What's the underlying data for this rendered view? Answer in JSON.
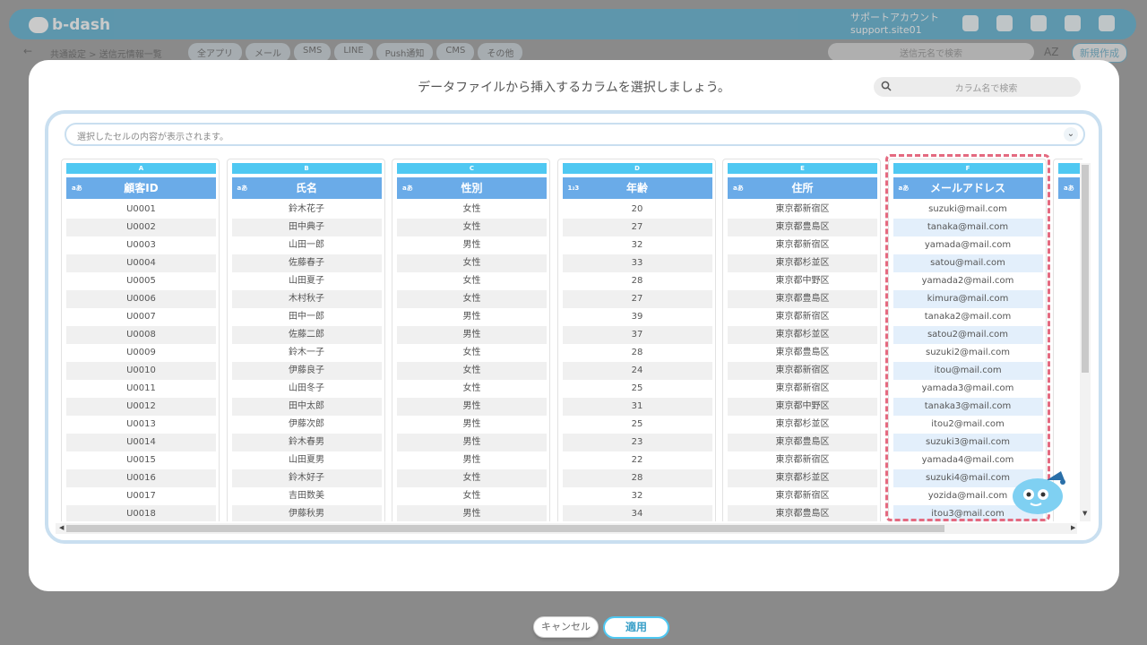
{
  "app": {
    "logo": "b-dash",
    "account_line1": "サポートアカウント",
    "account_line2": "support.site01",
    "back": "←",
    "breadcrumb": "共通設定 > 送信元情報一覧",
    "categories": [
      "全アプリ",
      "メール",
      "SMS",
      "LINE",
      "Push通知",
      "CMS",
      "その他"
    ],
    "search_placeholder": "送信元名で検索",
    "sort_label": "AZ",
    "new_button": "新規作成"
  },
  "modal": {
    "title": "データファイルから挿入するカラムを選択しましょう。",
    "column_search_placeholder": "カラム名で検索",
    "preview_placeholder": "選択したセルの内容が表示されます。",
    "preview_chevron": "⌄",
    "cancel_label": "キャンセル",
    "apply_label": "適用"
  },
  "columns": [
    {
      "letter": "A",
      "type": "aあ",
      "name": "顧客ID",
      "values": [
        "U0001",
        "U0002",
        "U0003",
        "U0004",
        "U0005",
        "U0006",
        "U0007",
        "U0008",
        "U0009",
        "U0010",
        "U0011",
        "U0012",
        "U0013",
        "U0014",
        "U0015",
        "U0016",
        "U0017",
        "U0018"
      ]
    },
    {
      "letter": "B",
      "type": "aあ",
      "name": "氏名",
      "values": [
        "鈴木花子",
        "田中典子",
        "山田一郎",
        "佐藤春子",
        "山田夏子",
        "木村秋子",
        "田中一郎",
        "佐藤二郎",
        "鈴木一子",
        "伊藤良子",
        "山田冬子",
        "田中太郎",
        "伊藤次郎",
        "鈴木春男",
        "山田夏男",
        "鈴木好子",
        "吉田数美",
        "伊藤秋男"
      ]
    },
    {
      "letter": "C",
      "type": "aあ",
      "name": "性別",
      "values": [
        "女性",
        "女性",
        "男性",
        "女性",
        "女性",
        "女性",
        "男性",
        "男性",
        "女性",
        "女性",
        "女性",
        "男性",
        "男性",
        "男性",
        "男性",
        "女性",
        "女性",
        "男性"
      ]
    },
    {
      "letter": "D",
      "type": "1₂3",
      "name": "年齢",
      "values": [
        "20",
        "27",
        "32",
        "33",
        "28",
        "27",
        "39",
        "37",
        "28",
        "24",
        "25",
        "31",
        "25",
        "23",
        "22",
        "28",
        "32",
        "34"
      ]
    },
    {
      "letter": "E",
      "type": "aあ",
      "name": "住所",
      "values": [
        "東京都新宿区",
        "東京都豊島区",
        "東京都新宿区",
        "東京都杉並区",
        "東京都中野区",
        "東京都豊島区",
        "東京都新宿区",
        "東京都杉並区",
        "東京都豊島区",
        "東京都新宿区",
        "東京都新宿区",
        "東京都中野区",
        "東京都杉並区",
        "東京都豊島区",
        "東京都新宿区",
        "東京都杉並区",
        "東京都新宿区",
        "東京都豊島区"
      ]
    },
    {
      "letter": "F",
      "type": "aあ",
      "name": "メールアドレス",
      "selected": true,
      "values": [
        "suzuki@mail.com",
        "tanaka@mail.com",
        "yamada@mail.com",
        "satou@mail.com",
        "yamada2@mail.com",
        "kimura@mail.com",
        "tanaka2@mail.com",
        "satou2@mail.com",
        "suzuki2@mail.com",
        "itou@mail.com",
        "yamada3@mail.com",
        "tanaka3@mail.com",
        "itou2@mail.com",
        "suzuki3@mail.com",
        "yamada4@mail.com",
        "suzuki4@mail.com",
        "yozida@mail.com",
        "itou3@mail.com"
      ]
    },
    {
      "letter": "",
      "type": "aあ",
      "name": "",
      "values": []
    }
  ],
  "colors": {
    "accent": "#4fc8f2",
    "header_blue": "#6aabe8",
    "selection_dash": "#e46a80"
  }
}
